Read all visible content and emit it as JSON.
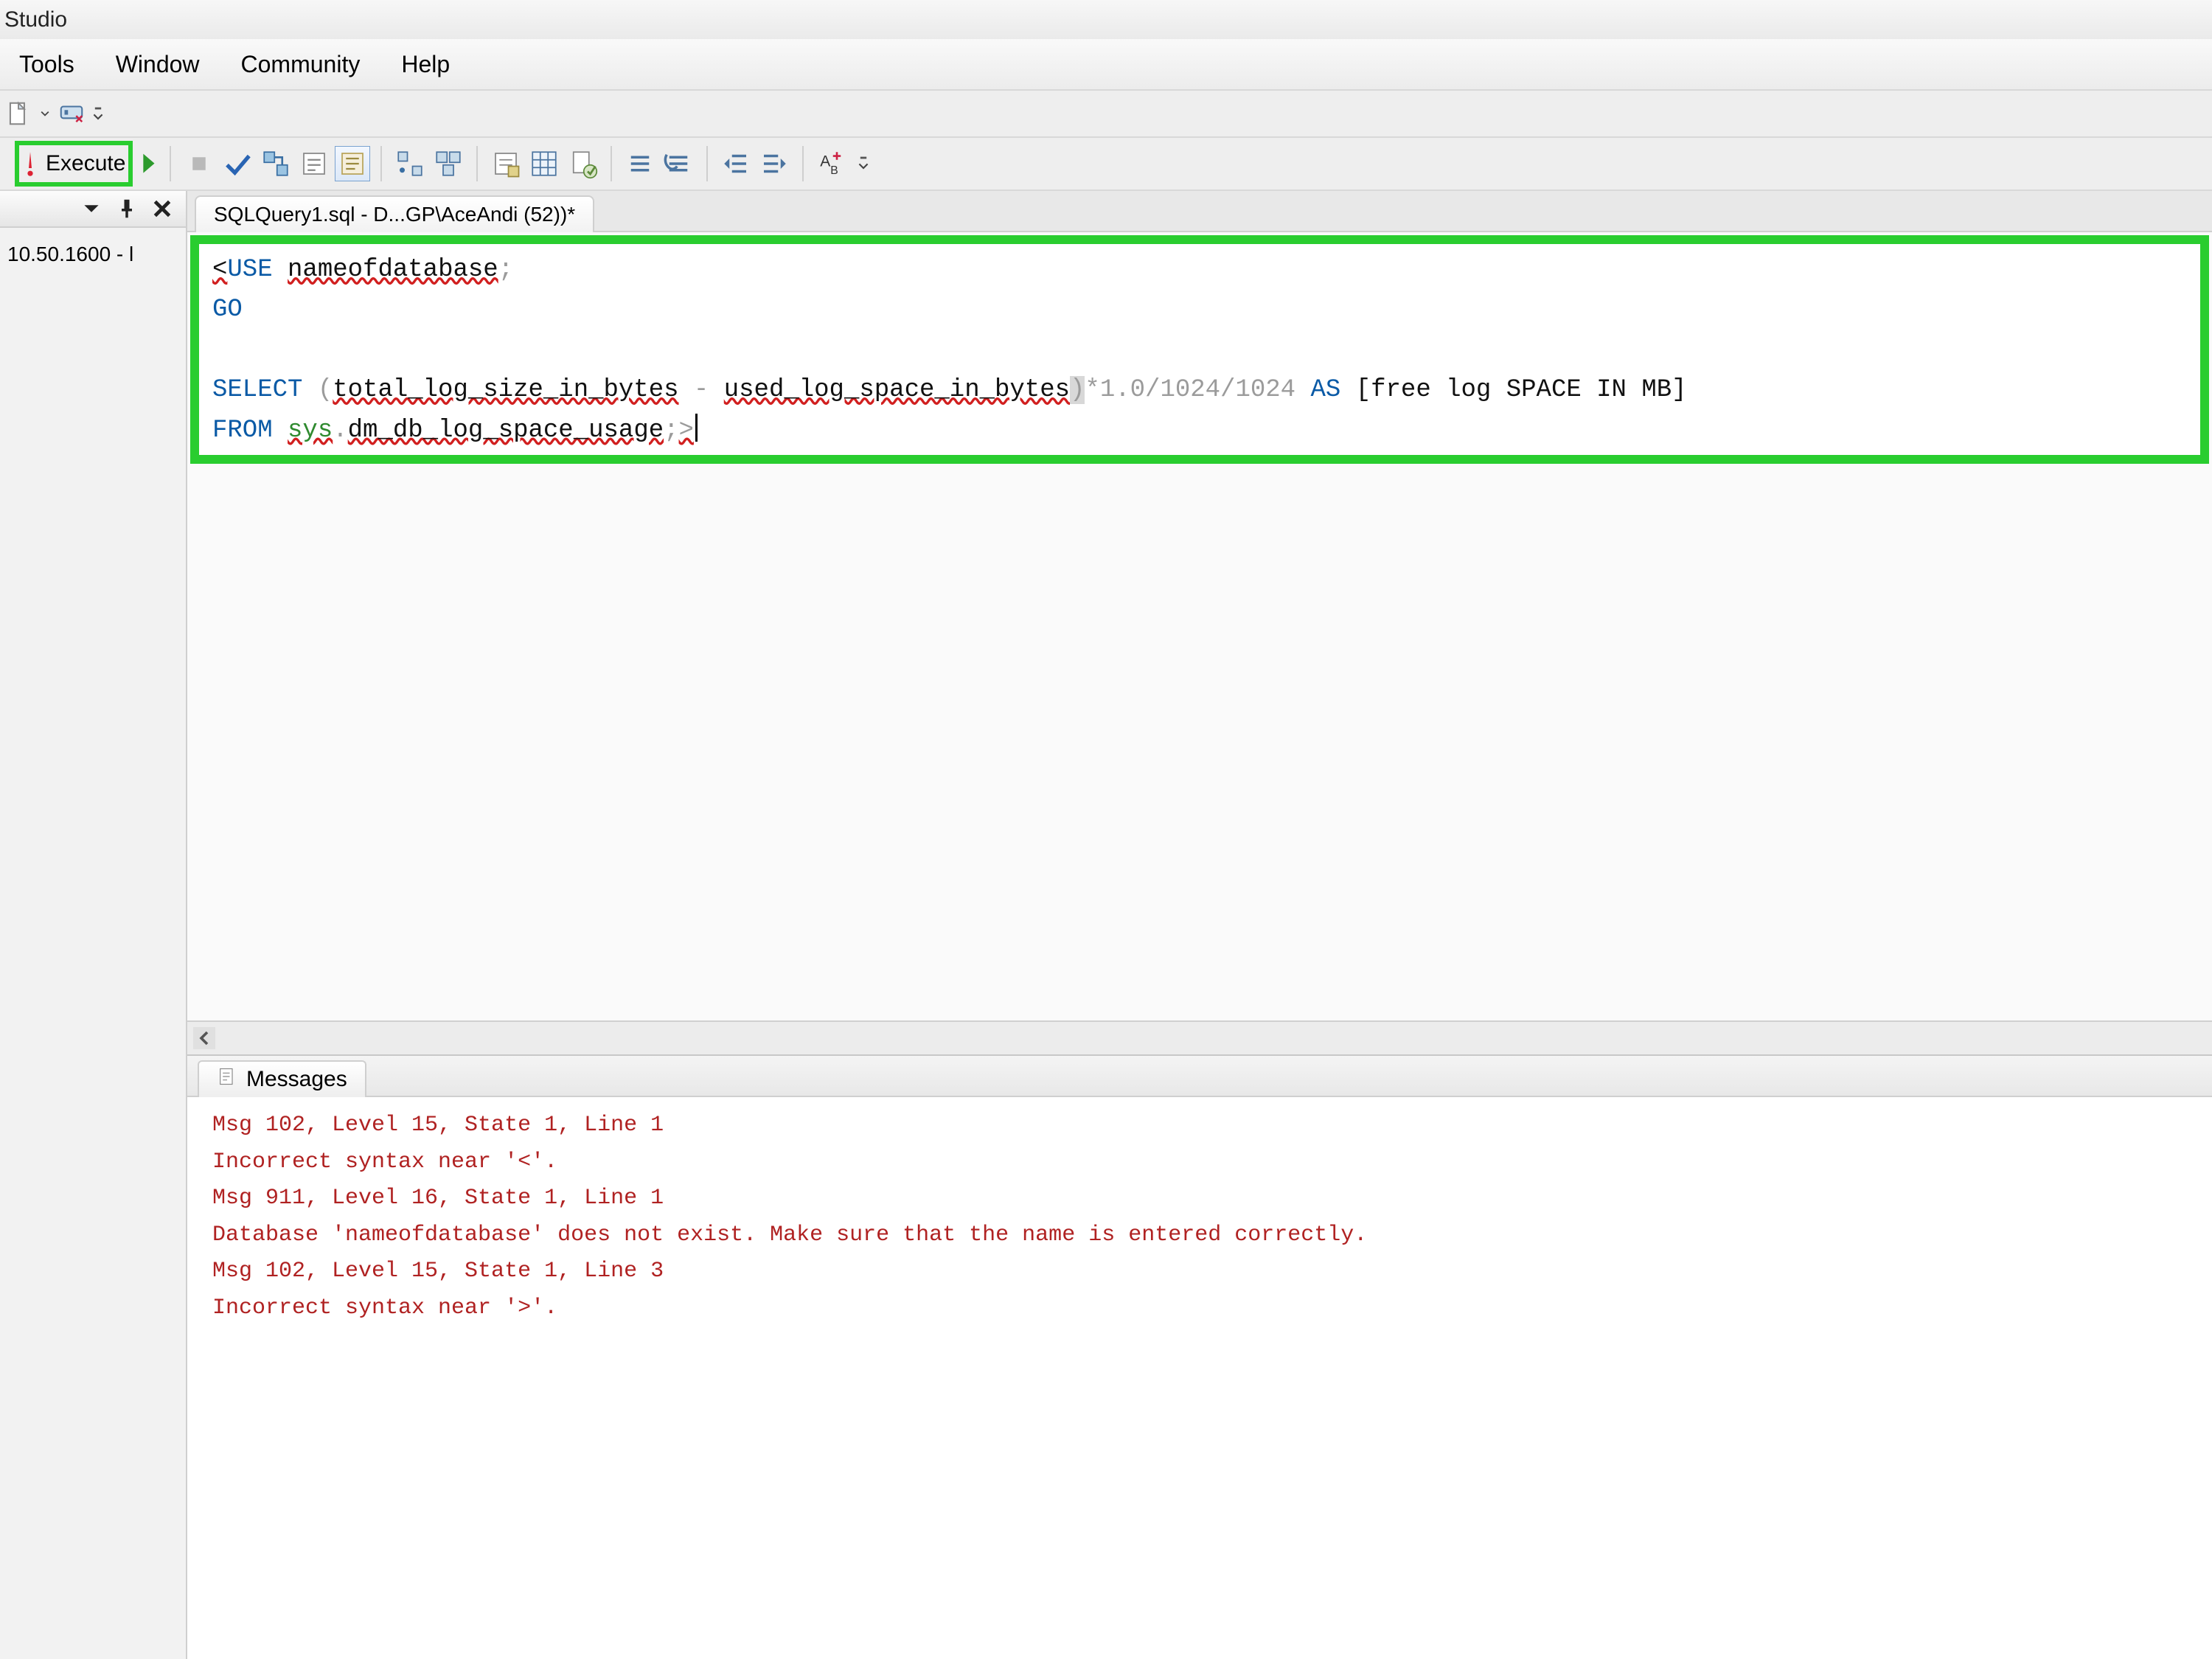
{
  "title_bar": {
    "text": "Studio"
  },
  "menu": {
    "items": [
      "Tools",
      "Window",
      "Community",
      "Help"
    ]
  },
  "toolbar2": {
    "execute_label": "Execute"
  },
  "sidebar": {
    "version_text": "10.50.1600 - l"
  },
  "tab": {
    "label": "SQLQuery1.sql - D...GP\\AceAndi (52))*"
  },
  "sql": {
    "line1_lt_char": "<",
    "line1_use": "USE",
    "line1_db": "nameofdatabase",
    "line1_end": ";",
    "line2_go": "GO",
    "line3_select": "SELECT",
    "line3_open": " (",
    "line3_total": "total_log_size_in_bytes",
    "line3_minus": " - ",
    "line3_used": "used_log_space_in_bytes",
    "line3_close": ")",
    "line3_math": "*1.0/1024/1024 ",
    "line3_as": "AS",
    "line3_alias": " [free log SPACE IN MB]",
    "line4_from": "FROM",
    "line4_space": " ",
    "line4_sys": "sys",
    "line4_dot": ".",
    "line4_view": "dm_db_log_space_usage",
    "line4_semi": ";",
    "line4_gt": ">"
  },
  "messages": {
    "tab_label": "Messages",
    "lines": [
      "Msg 102, Level 15, State 1, Line 1",
      "Incorrect syntax near '<'.",
      "Msg 911, Level 16, State 1, Line 1",
      "Database 'nameofdatabase' does not exist. Make sure that the name is entered correctly.",
      "Msg 102, Level 15, State 1, Line 3",
      "Incorrect syntax near '>'."
    ]
  }
}
